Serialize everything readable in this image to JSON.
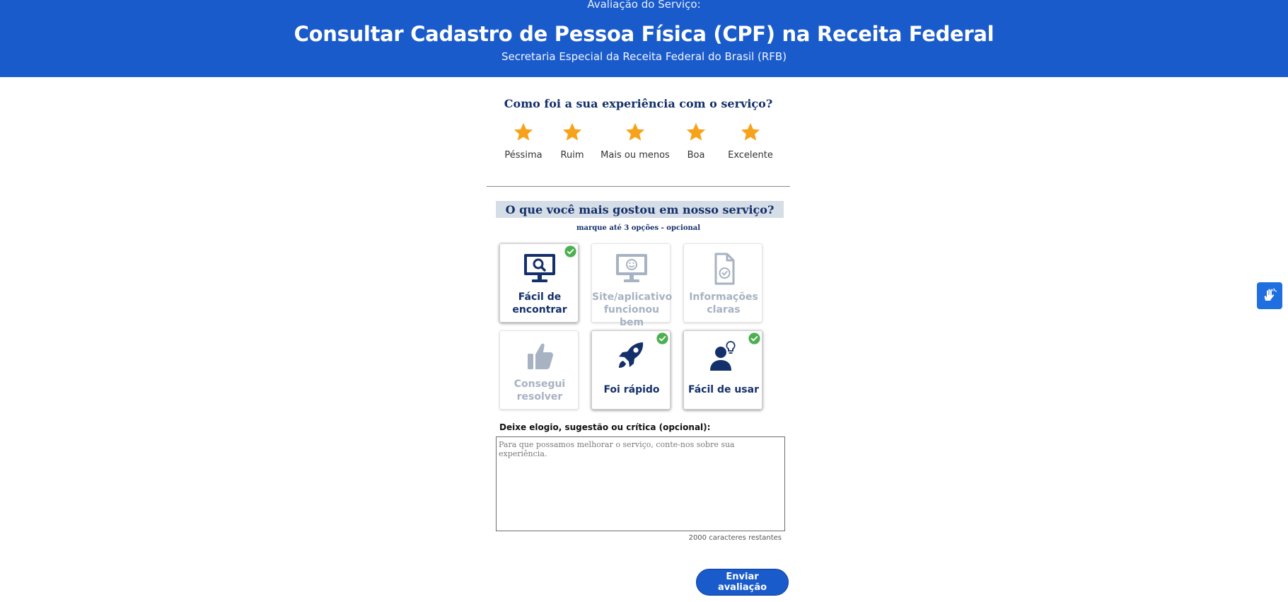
{
  "header": {
    "subtitle_top": "Avaliação do Serviço:",
    "title": "Consultar Cadastro de Pessoa Física (CPF) na Receita Federal",
    "agency": "Secretaria Especial da Receita Federal do Brasil (RFB)",
    "background_color": "#1a5bcb"
  },
  "experience": {
    "question": "Como foi a sua experiência com o serviço?",
    "star_color": "#f7a21b",
    "options": [
      {
        "label": "Péssima",
        "icon": "star-icon"
      },
      {
        "label": "Ruim",
        "icon": "star-icon"
      },
      {
        "label": "Mais ou menos",
        "icon": "star-icon"
      },
      {
        "label": "Boa",
        "icon": "star-icon"
      },
      {
        "label": "Excelente",
        "icon": "star-icon"
      }
    ]
  },
  "liked": {
    "question": "O que você mais gostou em nosso serviço?",
    "hint": "marque até 3 opções - opcional",
    "options": [
      {
        "line1": "Fácil de",
        "line2": "encontrar",
        "icon": "monitor-search-icon",
        "selected": true
      },
      {
        "line1": "Site/aplicativo",
        "line2": "funcionou bem",
        "icon": "monitor-smile-icon",
        "selected": false
      },
      {
        "line1": "Informações",
        "line2": "claras",
        "icon": "document-check-icon",
        "selected": false
      },
      {
        "line1": "Consegui",
        "line2": "resolver",
        "icon": "thumbs-up-icon",
        "selected": false
      },
      {
        "line1": "Foi rápido",
        "line2": "",
        "icon": "rocket-icon",
        "selected": true
      },
      {
        "line1": "Fácil de usar",
        "line2": "",
        "icon": "person-lightbulb-icon",
        "selected": true
      }
    ],
    "selected_color": "#14306a",
    "unselected_color": "#a7b2c2",
    "check_color": "#4caf50"
  },
  "comment": {
    "label": "Deixe elogio, sugestão ou crítica (opcional):",
    "placeholder": "Para que possamos melhorar o serviço, conte-nos sobre sua experiência.",
    "value": "",
    "remaining": "2000 caracteres restantes"
  },
  "submit": {
    "label": "Enviar avaliação"
  },
  "accessibility_widget": {
    "icon": "sign-language-hands-icon",
    "color": "#1f6fe0"
  }
}
